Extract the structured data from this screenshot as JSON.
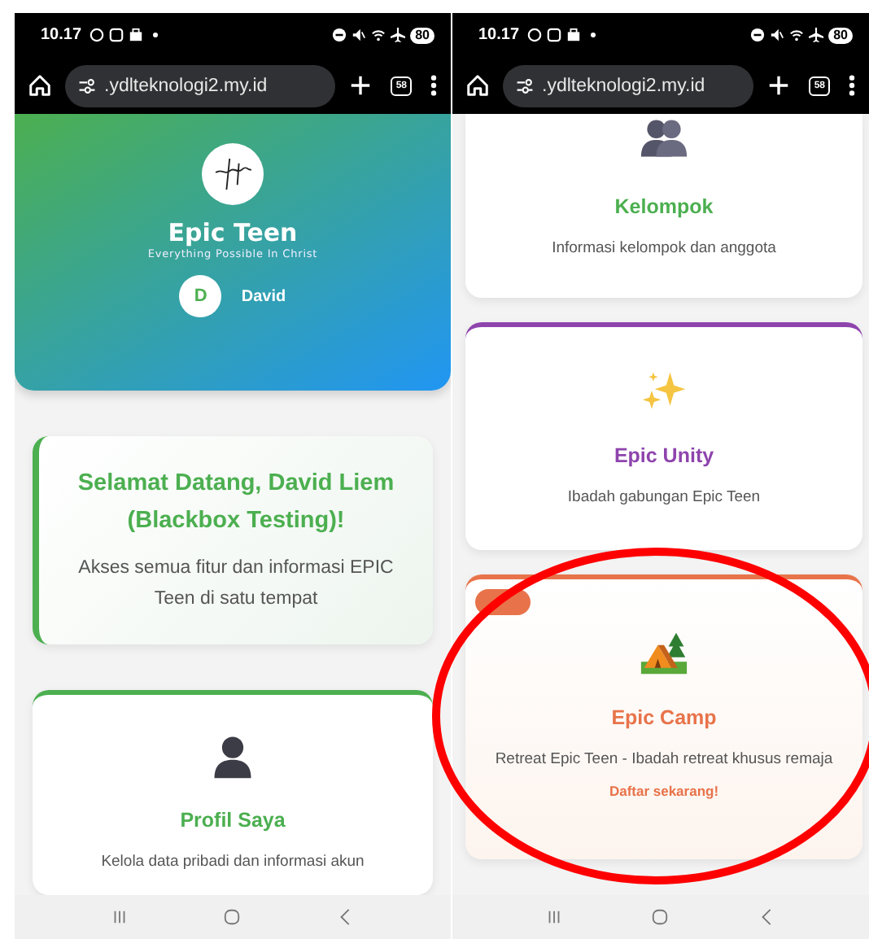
{
  "phones": [
    {
      "status_bar": {
        "time": "10.17",
        "battery": "80"
      },
      "browser": {
        "url": ".ydlteknologi2.my.id",
        "tab_count": "58"
      },
      "cards": [
        {
          "kind": "hero",
          "title": "Epic Teen",
          "tagline": "Everything Possible In Christ",
          "avatar": "D",
          "user": "David"
        },
        {
          "kind": "welcome",
          "title": "Selamat Datang, David Liem (Blackbox Testing)!",
          "text": "Akses semua fitur dan informasi EPIC Teen di satu tempat",
          "color": "#4caf50"
        },
        {
          "kind": "profile",
          "title": "Profil Saya",
          "text": "Kelola data pribadi dan informasi akun",
          "color": "#4caf50"
        }
      ]
    },
    {
      "status_bar": {
        "time": "10.17",
        "battery": "80"
      },
      "browser": {
        "url": ".ydlteknologi2.my.id",
        "tab_count": "58"
      },
      "cards": [
        {
          "kind": "group",
          "title": "Kelompok",
          "text": "Informasi kelompok dan anggota",
          "color": "#4caf50"
        },
        {
          "kind": "unity",
          "title": "Epic Unity",
          "text": "Ibadah gabungan Epic Teen",
          "color": "#8e44ad"
        },
        {
          "kind": "camp",
          "title": "Epic Camp",
          "text": "Retreat Epic Teen - Ibadah retreat khusus remaja",
          "cta": "Daftar sekarang!",
          "tagged": true,
          "color": "#e8734a"
        }
      ]
    }
  ]
}
